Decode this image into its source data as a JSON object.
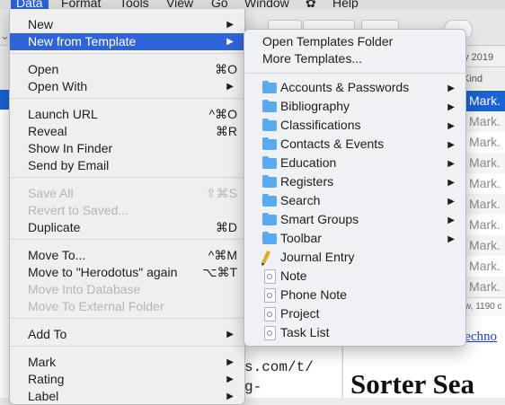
{
  "menubar": {
    "items": [
      "Data",
      "Format",
      "Tools",
      "View",
      "Go",
      "Window",
      "Help"
    ],
    "active": "Data"
  },
  "background": {
    "date_header": "ay 2019",
    "kind_header": "Kind",
    "kind_cells": [
      "Mark.",
      "Mark.",
      "Mark.",
      "Mark.",
      "Mark.",
      "Mark.",
      "Mark.",
      "Mark.",
      "Mark.",
      "Mark."
    ],
    "status": "w, 1190 c",
    "link_text": "techno",
    "heading": "Sorter Sea",
    "mono_lines": [
      "s.com/t/",
      "g-"
    ],
    "left_letters": [
      "N",
      "d",
      "n",
      "i",
      "s",
      "T"
    ]
  },
  "data_menu": {
    "items": [
      {
        "label": "New",
        "shortcut": "",
        "submenu": true,
        "disabled": false
      },
      {
        "label": "New from Template",
        "shortcut": "",
        "submenu": true,
        "disabled": false,
        "highlighted": true
      },
      {
        "label": "Open",
        "shortcut": "⌘O",
        "submenu": false,
        "disabled": false
      },
      {
        "label": "Open With",
        "shortcut": "",
        "submenu": true,
        "disabled": false
      },
      {
        "label": "Launch URL",
        "shortcut": "^⌘O",
        "submenu": false,
        "disabled": false
      },
      {
        "label": "Reveal",
        "shortcut": "⌘R",
        "submenu": false,
        "disabled": false
      },
      {
        "label": "Show In Finder",
        "shortcut": "",
        "submenu": false,
        "disabled": false
      },
      {
        "label": "Send by Email",
        "shortcut": "",
        "submenu": false,
        "disabled": false
      },
      {
        "label": "Save All",
        "shortcut": "⇧⌘S",
        "submenu": false,
        "disabled": true
      },
      {
        "label": "Revert to Saved...",
        "shortcut": "",
        "submenu": false,
        "disabled": true
      },
      {
        "label": "Duplicate",
        "shortcut": "⌘D",
        "submenu": false,
        "disabled": false
      },
      {
        "label": "Move To...",
        "shortcut": "^⌘M",
        "submenu": false,
        "disabled": false
      },
      {
        "label": "Move to \"Herodotus\" again",
        "shortcut": "⌥⌘T",
        "submenu": false,
        "disabled": false
      },
      {
        "label": "Move Into Database",
        "shortcut": "",
        "submenu": false,
        "disabled": true
      },
      {
        "label": "Move To External Folder",
        "shortcut": "",
        "submenu": false,
        "disabled": true
      },
      {
        "label": "Add To",
        "shortcut": "",
        "submenu": true,
        "disabled": false
      },
      {
        "label": "Mark",
        "shortcut": "",
        "submenu": true,
        "disabled": false
      },
      {
        "label": "Rating",
        "shortcut": "",
        "submenu": true,
        "disabled": false
      },
      {
        "label": "Label",
        "shortcut": "",
        "submenu": true,
        "disabled": false
      }
    ]
  },
  "template_submenu": {
    "top_items": [
      {
        "label": "Open Templates Folder"
      },
      {
        "label": "More Templates..."
      }
    ],
    "items": [
      {
        "label": "Accounts & Passwords",
        "icon": "folder-icon",
        "submenu": true
      },
      {
        "label": "Bibliography",
        "icon": "folder-icon",
        "submenu": true
      },
      {
        "label": "Classifications",
        "icon": "folder-icon",
        "submenu": true
      },
      {
        "label": "Contacts & Events",
        "icon": "folder-icon",
        "submenu": true
      },
      {
        "label": "Education",
        "icon": "folder-icon",
        "submenu": true
      },
      {
        "label": "Registers",
        "icon": "folder-icon",
        "submenu": true
      },
      {
        "label": "Search",
        "icon": "folder-icon",
        "submenu": true
      },
      {
        "label": "Smart Groups",
        "icon": "folder-icon",
        "submenu": true
      },
      {
        "label": "Toolbar",
        "icon": "folder-icon",
        "submenu": true
      },
      {
        "label": "Journal Entry",
        "icon": "pencil-icon",
        "submenu": false
      },
      {
        "label": "Note",
        "icon": "document-icon",
        "submenu": false
      },
      {
        "label": "Phone Note",
        "icon": "document-icon",
        "submenu": false
      },
      {
        "label": "Project",
        "icon": "document-icon",
        "submenu": false
      },
      {
        "label": "Task List",
        "icon": "document-icon",
        "submenu": false
      }
    ]
  },
  "colors": {
    "highlight": "#2f64d9",
    "selection": "#1b62d4",
    "folder": "#5aaaf0",
    "link": "#1f47c8"
  }
}
